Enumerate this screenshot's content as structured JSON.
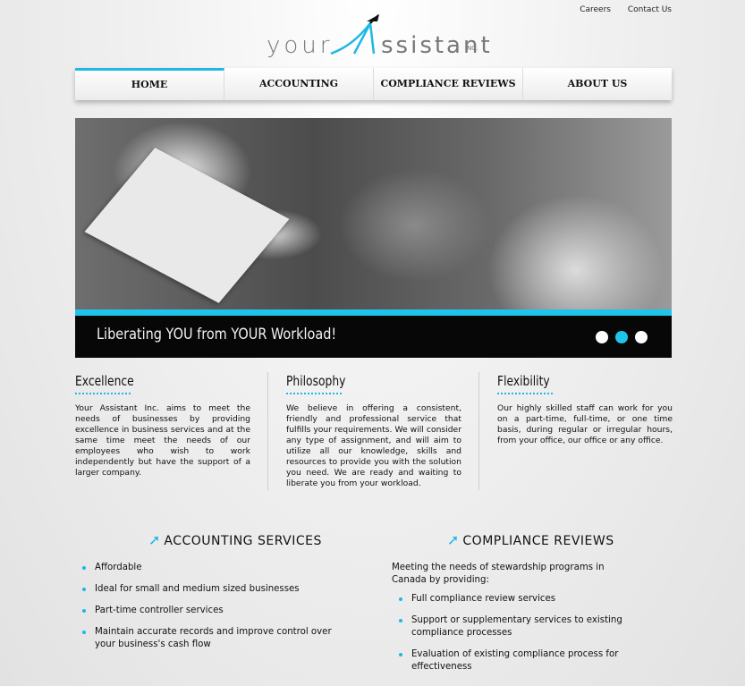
{
  "top_links": {
    "careers": "Careers",
    "contact": "Contact Us"
  },
  "logo": {
    "part1": "your",
    "part2": "ssistant",
    "inc": "INC."
  },
  "nav": {
    "tabs": [
      {
        "label": "HOME",
        "active": true
      },
      {
        "label": "ACCOUNTING",
        "active": false
      },
      {
        "label": "COMPLIANCE REVIEWS",
        "active": false
      },
      {
        "label": "ABOUT US",
        "active": false
      }
    ]
  },
  "hero": {
    "caption": "Liberating YOU from YOUR Workload!",
    "slide_count": 3,
    "active_slide": 2
  },
  "columns": [
    {
      "title": "Excellence",
      "text": "Your Assistant Inc. aims to meet the needs of businesses by providing excellence in business services and at the same time meet the needs of our employees who wish to work independently but have the support of a larger company."
    },
    {
      "title": "Philosophy",
      "text": "We believe in offering a consistent, friendly and professional service that fulfills your requirements. We will consider any type of assignment, and will aim to utilize all our knowledge, skills and resources to provide you with the solution you need. We are ready and waiting to liberate you from your workload."
    },
    {
      "title": "Flexibility",
      "text": "Our highly skilled staff can work for you on a part-time, full-time, or one time basis, during regular or irregular hours, from your office, our office or any office."
    }
  ],
  "accounting": {
    "title": "ACCOUNTING SERVICES",
    "items": [
      "Affordable",
      "Ideal for small and medium sized businesses",
      "Part-time controller services",
      "Maintain accurate records and improve control over your business's cash flow"
    ]
  },
  "compliance": {
    "title": "COMPLIANCE REVIEWS",
    "intro": "Meeting the needs of stewardship programs in Canada by providing:",
    "items": [
      "Full compliance review services",
      "Support or supplementary services to existing compliance processes",
      "Evaluation of existing compliance process for effectiveness"
    ]
  },
  "colors": {
    "accent": "#1fb8e3",
    "band": "#1fc4ea",
    "caption_bg": "#070707"
  }
}
